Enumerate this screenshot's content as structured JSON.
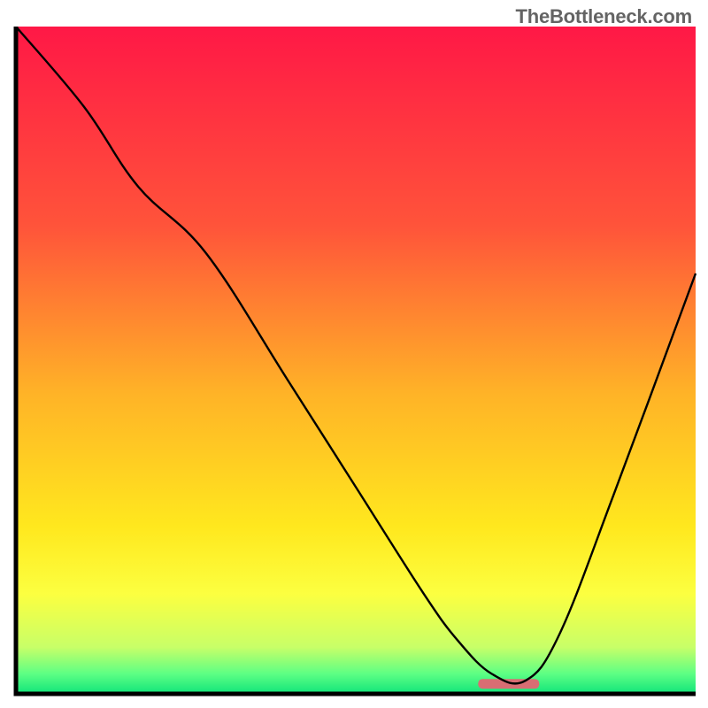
{
  "watermark": "TheBottleneck.com",
  "chart_data": {
    "type": "line",
    "title": "",
    "xlabel": "",
    "ylabel": "",
    "xlim": [
      0,
      100
    ],
    "ylim": [
      0,
      100
    ],
    "gradient_stops": [
      {
        "offset": 0,
        "color": "#ff1846"
      },
      {
        "offset": 30,
        "color": "#ff543a"
      },
      {
        "offset": 55,
        "color": "#ffb327"
      },
      {
        "offset": 75,
        "color": "#ffe81e"
      },
      {
        "offset": 85,
        "color": "#fcff40"
      },
      {
        "offset": 93,
        "color": "#c8ff68"
      },
      {
        "offset": 97,
        "color": "#5dff84"
      },
      {
        "offset": 100,
        "color": "#10e47a"
      }
    ],
    "series": [
      {
        "name": "bottleneck-curve",
        "x": [
          0,
          10,
          18,
          28,
          40,
          50,
          60,
          65,
          70,
          75,
          80,
          88,
          100
        ],
        "y": [
          100,
          88,
          76,
          66,
          47,
          31,
          15,
          8,
          3,
          2,
          9,
          30,
          63
        ]
      }
    ],
    "marker": {
      "name": "optimal-range",
      "x_start": 68,
      "x_end": 77,
      "y": 1.5,
      "color": "#d96d73"
    }
  }
}
